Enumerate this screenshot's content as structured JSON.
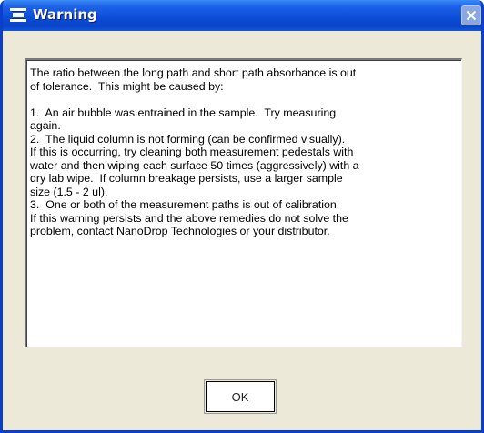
{
  "window": {
    "title": "Warning",
    "title_icon": "dialog-menu-icon",
    "close_icon": "close-icon"
  },
  "message": {
    "lines": [
      "The ratio between the long path and short path absorbance is out",
      "of tolerance.  This might be caused by:",
      "",
      "1.  An air bubble was entrained in the sample.  Try measuring",
      "again.",
      "2.  The liquid column is not forming (can be confirmed visually).",
      "If this is occurring, try cleaning both measurement pedestals with",
      "water and then wiping each surface 50 times (aggressively) with a",
      "dry lab wipe.  If column breakage persists, use a larger sample",
      "size (1.5 - 2 ul).",
      "3.  One or both of the measurement paths is out of calibration.",
      "If this warning persists and the above remedies do not solve the",
      "problem, contact NanoDrop Technologies or your distributor."
    ]
  },
  "buttons": {
    "ok_label": "OK"
  },
  "colors": {
    "titlebar": "#0a44c8",
    "dialog_background": "#ece9d8",
    "message_background": "#ffffff"
  }
}
